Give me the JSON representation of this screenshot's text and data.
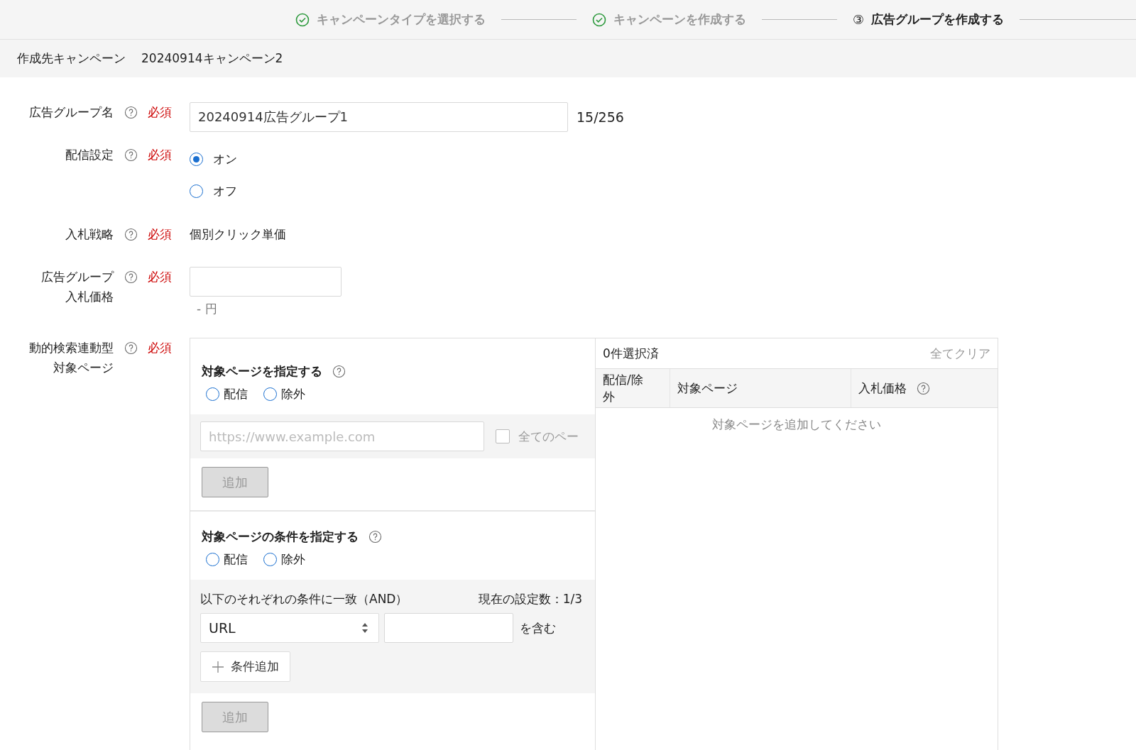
{
  "steps": [
    {
      "label": "キャンペーンタイプを選択する",
      "done": true,
      "current": false
    },
    {
      "label": "キャンペーンを作成する",
      "done": true,
      "current": false
    },
    {
      "label": "広告グループを作成する",
      "done": false,
      "current": true,
      "number": "③"
    }
  ],
  "campaign_bar": {
    "label": "作成先キャンペーン",
    "value": "20240914キャンペーン2"
  },
  "fields": [
    {
      "kind": "text",
      "label_lines": [
        "広告グループ名"
      ],
      "required": "必須",
      "value": "20240914広告グループ1",
      "counter": "15/256"
    },
    {
      "kind": "radio",
      "label_lines": [
        "配信設定"
      ],
      "required": "必須",
      "options": [
        {
          "label": "オン",
          "selected": true
        },
        {
          "label": "オフ",
          "selected": false
        }
      ]
    },
    {
      "kind": "static",
      "label_lines": [
        "入札戦略"
      ],
      "required": "必須",
      "value": "個別クリック単価"
    },
    {
      "kind": "price",
      "label_lines": [
        "広告グループ",
        "入札価格"
      ],
      "required": "必須",
      "note": "- 円"
    },
    {
      "kind": "target",
      "label_lines": [
        "動的検索連動型",
        "対象ページ"
      ],
      "required": "必須"
    }
  ],
  "target_pages": {
    "specify": {
      "title": "対象ページを指定する",
      "options": [
        {
          "label": "配信",
          "selected": false
        },
        {
          "label": "除外",
          "selected": false
        }
      ],
      "url_placeholder": "https://www.example.com",
      "all_pages": {
        "label": "全てのペー",
        "checked": false
      },
      "add_button": {
        "label": "追加",
        "disabled": true
      }
    },
    "conditions": {
      "title": "対象ページの条件を指定する",
      "options": [
        {
          "label": "配信",
          "selected": false
        },
        {
          "label": "除外",
          "selected": false
        }
      ],
      "match_label": "以下のそれぞれの条件に一致（AND）",
      "count_label": "現在の設定数：1/3",
      "rows": [
        {
          "type": "URL",
          "suffix": "を含む"
        }
      ],
      "add_condition": "条件追加",
      "add_button": {
        "label": "追加",
        "disabled": true
      }
    },
    "selection": {
      "count": "0件選択済",
      "clear": "全てクリア",
      "columns": [
        {
          "label": "配信/除外",
          "help": false
        },
        {
          "label": "対象ページ",
          "help": false
        },
        {
          "label": "入札価格",
          "help": true
        }
      ],
      "empty": "対象ページを追加してください"
    }
  }
}
